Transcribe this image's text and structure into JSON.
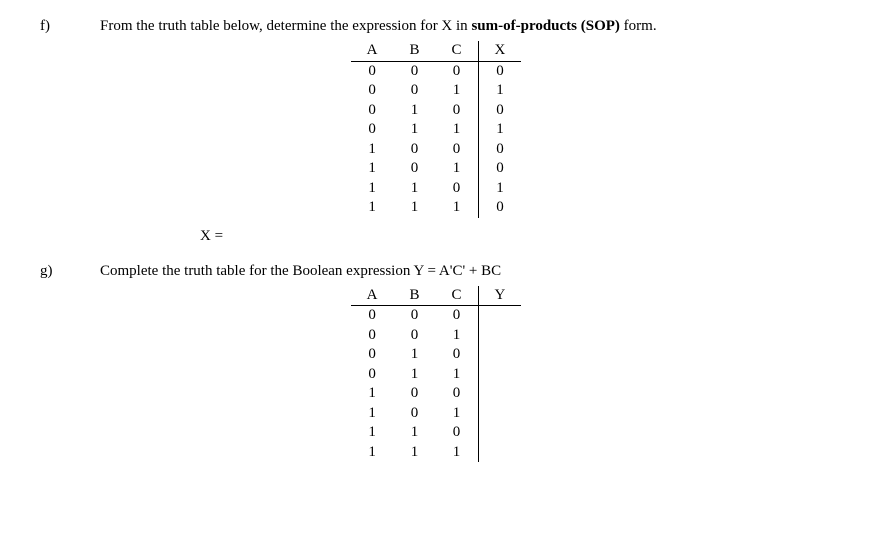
{
  "qf": {
    "label": "f)",
    "prompt_pre": "From the truth table below, determine the expression for X in ",
    "prompt_bold": "sum-of-products (SOP)",
    "prompt_post": " form.",
    "headers": [
      "A",
      "B",
      "C",
      "X"
    ],
    "rows": [
      [
        "0",
        "0",
        "0",
        "0"
      ],
      [
        "0",
        "0",
        "1",
        "1"
      ],
      [
        "0",
        "1",
        "0",
        "0"
      ],
      [
        "0",
        "1",
        "1",
        "1"
      ],
      [
        "1",
        "0",
        "0",
        "0"
      ],
      [
        "1",
        "0",
        "1",
        "0"
      ],
      [
        "1",
        "1",
        "0",
        "1"
      ],
      [
        "1",
        "1",
        "1",
        "0"
      ]
    ],
    "answer_label": "X ="
  },
  "qg": {
    "label": "g)",
    "prompt": "Complete the truth table for the Boolean expression Y = A'C' + BC",
    "headers": [
      "A",
      "B",
      "C",
      "Y"
    ],
    "rows": [
      [
        "0",
        "0",
        "0",
        ""
      ],
      [
        "0",
        "0",
        "1",
        ""
      ],
      [
        "0",
        "1",
        "0",
        ""
      ],
      [
        "0",
        "1",
        "1",
        ""
      ],
      [
        "1",
        "0",
        "0",
        ""
      ],
      [
        "1",
        "0",
        "1",
        ""
      ],
      [
        "1",
        "1",
        "0",
        ""
      ],
      [
        "1",
        "1",
        "1",
        ""
      ]
    ]
  }
}
